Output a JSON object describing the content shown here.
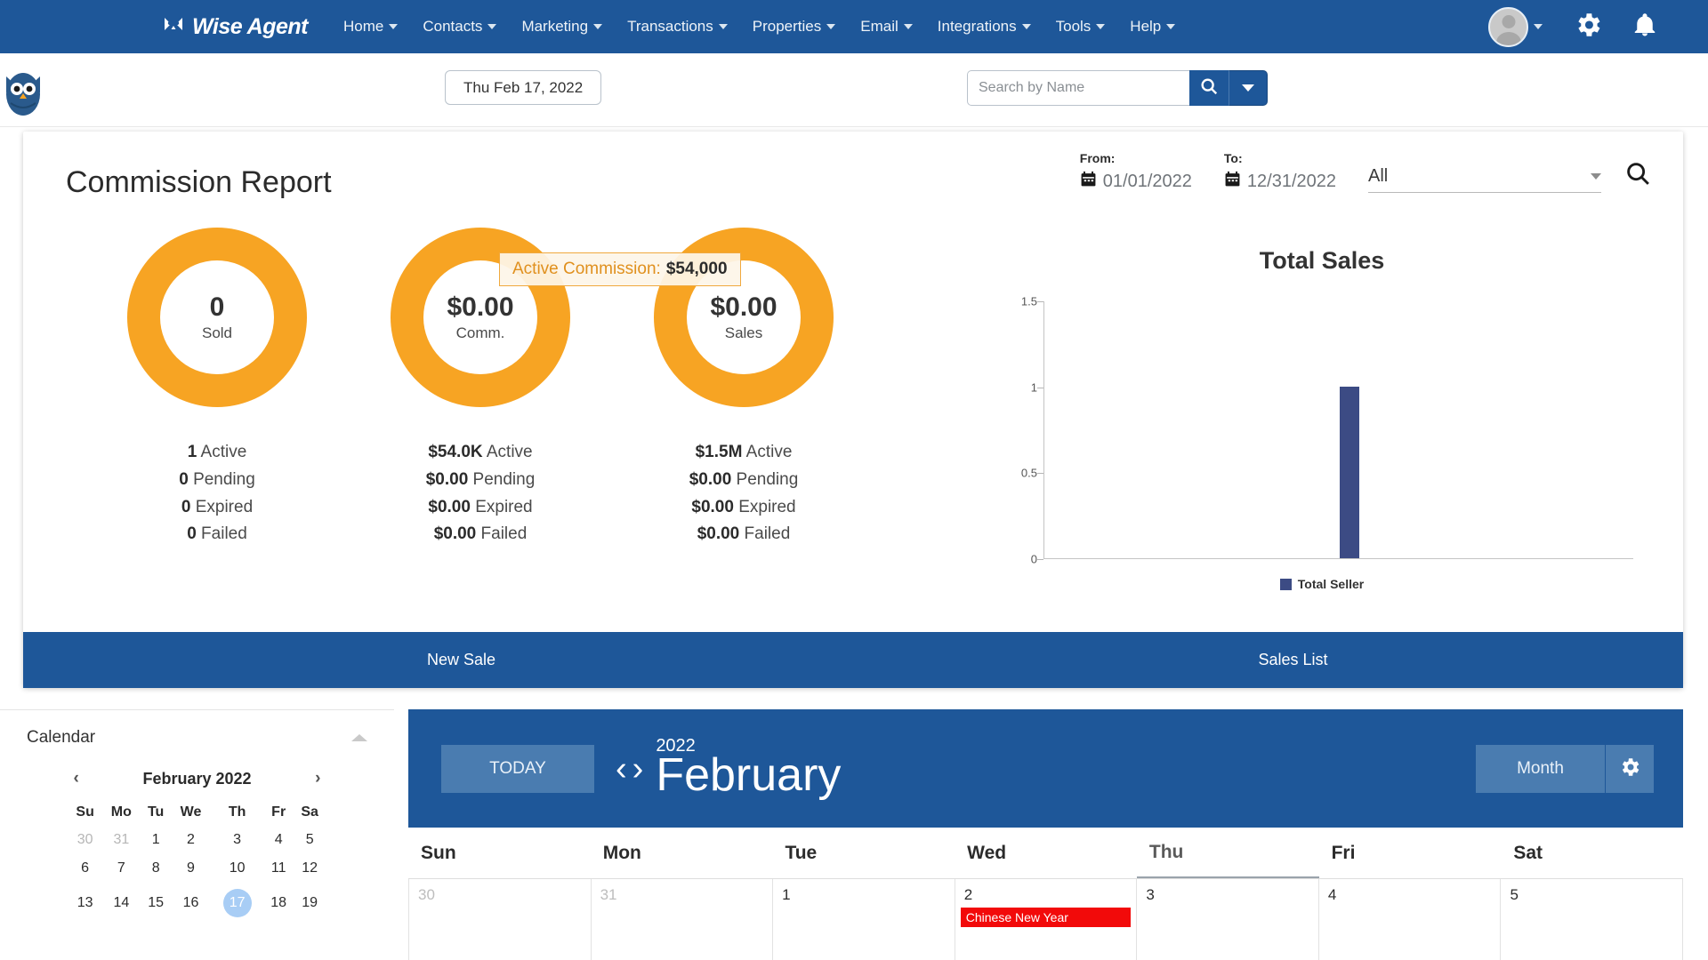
{
  "topnav": {
    "brand": "Wise Agent",
    "items": [
      {
        "label": "Home",
        "has_caret": true
      },
      {
        "label": "Contacts",
        "has_caret": true
      },
      {
        "label": "Marketing",
        "has_caret": true
      },
      {
        "label": "Transactions",
        "has_caret": true
      },
      {
        "label": "Properties",
        "has_caret": true
      },
      {
        "label": "Email",
        "has_caret": true
      },
      {
        "label": "Integrations",
        "has_caret": true
      },
      {
        "label": "Tools",
        "has_caret": true
      },
      {
        "label": "Help",
        "has_caret": true
      }
    ],
    "icons": [
      "avatar",
      "chevron-down-icon",
      "gear-icon",
      "bell-icon"
    ]
  },
  "subbar": {
    "date_pill": "Thu Feb 17, 2022",
    "search_placeholder": "Search by Name",
    "search_value": ""
  },
  "report": {
    "title": "Commission Report",
    "from_label": "From:",
    "from_value": "01/01/2022",
    "to_label": "To:",
    "to_value": "12/31/2022",
    "select_value": "All",
    "tooltip": {
      "key": "Active Commission:",
      "value": "$54,000"
    },
    "donuts": [
      {
        "value": "0",
        "label": "Sold",
        "stats": [
          {
            "num": "1",
            "name": "Active"
          },
          {
            "num": "0",
            "name": "Pending"
          },
          {
            "num": "0",
            "name": "Expired"
          },
          {
            "num": "0",
            "name": "Failed"
          }
        ]
      },
      {
        "value": "$0.00",
        "label": "Comm.",
        "stats": [
          {
            "num": "$54.0K",
            "name": "Active"
          },
          {
            "num": "$0.00",
            "name": "Pending"
          },
          {
            "num": "$0.00",
            "name": "Expired"
          },
          {
            "num": "$0.00",
            "name": "Failed"
          }
        ]
      },
      {
        "value": "$0.00",
        "label": "Sales",
        "stats": [
          {
            "num": "$1.5M",
            "name": "Active"
          },
          {
            "num": "$0.00",
            "name": "Pending"
          },
          {
            "num": "$0.00",
            "name": "Expired"
          },
          {
            "num": "$0.00",
            "name": "Failed"
          }
        ]
      }
    ],
    "footer": {
      "new_sale": "New Sale",
      "sales_list": "Sales List"
    }
  },
  "chart_data": {
    "type": "bar",
    "title": "Total Sales",
    "xlabel": "",
    "ylabel": "",
    "categories": [
      ""
    ],
    "series": [
      {
        "name": "Total Seller",
        "values": [
          1
        ],
        "color": "#3c4b84"
      }
    ],
    "yticks": [
      "1.5",
      "1",
      "0.5",
      "0"
    ],
    "ylim": [
      0,
      1.5
    ],
    "grid": false,
    "legend": {
      "position": "bottom",
      "entries": [
        "Total Seller"
      ]
    }
  },
  "calendar_widget": {
    "title": "Calendar",
    "month_year": "February 2022",
    "prev": "‹",
    "next": "›",
    "dow": [
      "Su",
      "Mo",
      "Tu",
      "We",
      "Th",
      "Fr",
      "Sa"
    ],
    "weeks": [
      [
        {
          "d": "30",
          "muted": true
        },
        {
          "d": "31",
          "muted": true
        },
        {
          "d": "1"
        },
        {
          "d": "2"
        },
        {
          "d": "3"
        },
        {
          "d": "4"
        },
        {
          "d": "5"
        }
      ],
      [
        {
          "d": "6"
        },
        {
          "d": "7"
        },
        {
          "d": "8"
        },
        {
          "d": "9"
        },
        {
          "d": "10"
        },
        {
          "d": "11"
        },
        {
          "d": "12"
        }
      ],
      [
        {
          "d": "13"
        },
        {
          "d": "14"
        },
        {
          "d": "15"
        },
        {
          "d": "16"
        },
        {
          "d": "17",
          "today": true
        },
        {
          "d": "18"
        },
        {
          "d": "19"
        }
      ]
    ]
  },
  "big_calendar": {
    "today_btn": "TODAY",
    "prev_arrow": "‹",
    "next_arrow": "›",
    "year": "2022",
    "month": "February",
    "view_btn": "Month",
    "dow": [
      {
        "label": "Sun",
        "active": false
      },
      {
        "label": "Mon",
        "active": false
      },
      {
        "label": "Tue",
        "active": false
      },
      {
        "label": "Wed",
        "active": false
      },
      {
        "label": "Thu",
        "active": true
      },
      {
        "label": "Fri",
        "active": false
      },
      {
        "label": "Sat",
        "active": false
      }
    ],
    "week": [
      {
        "num": "30",
        "muted": true,
        "event": null
      },
      {
        "num": "31",
        "muted": true,
        "event": null
      },
      {
        "num": "1",
        "muted": false,
        "event": null
      },
      {
        "num": "2",
        "muted": false,
        "event": "Chinese New Year"
      },
      {
        "num": "3",
        "muted": false,
        "event": null
      },
      {
        "num": "4",
        "muted": false,
        "event": null
      },
      {
        "num": "5",
        "muted": false,
        "event": null
      }
    ]
  },
  "colors": {
    "brand_blue": "#1e5799",
    "accent_orange": "#f7a423",
    "bar_navy": "#3c4b84",
    "event_red": "#f20a0a",
    "today_blue": "#a8cdf5"
  }
}
